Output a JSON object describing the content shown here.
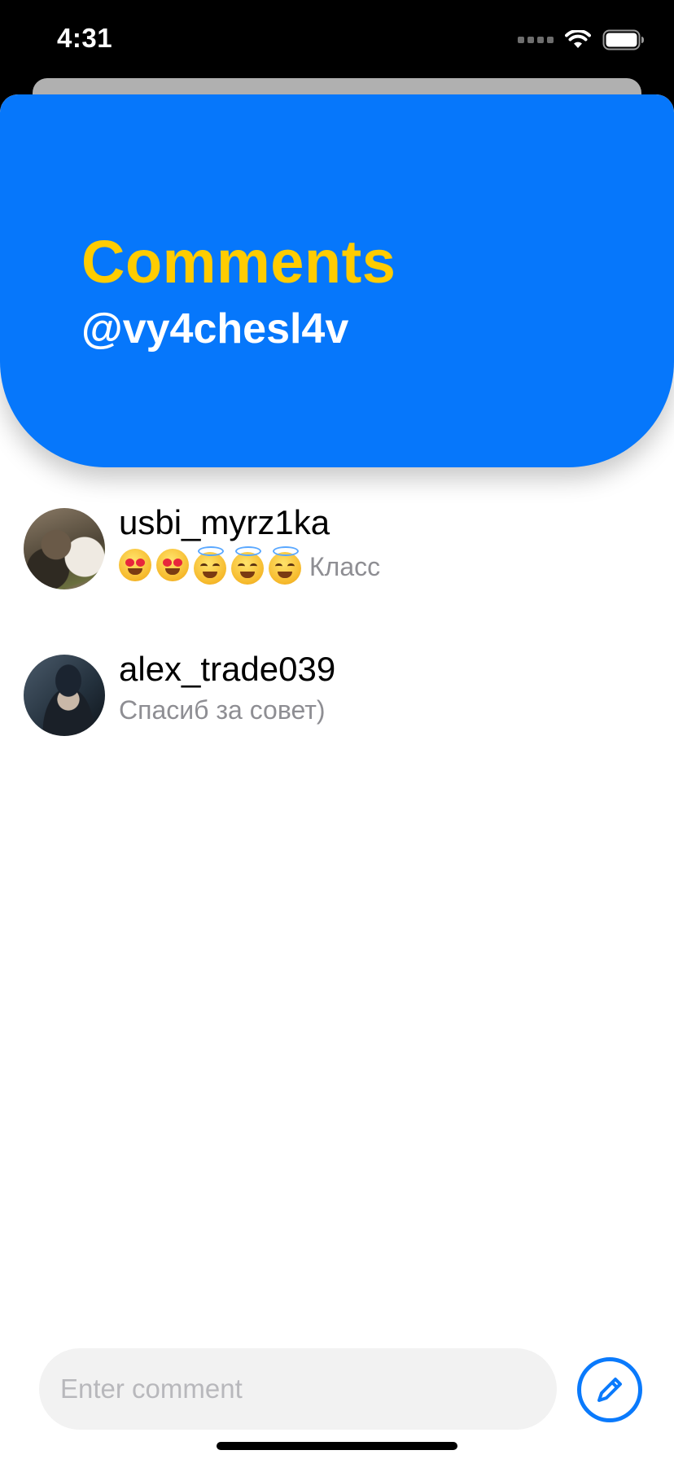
{
  "status_bar": {
    "time": "4:31",
    "icons": [
      "signal-icon",
      "wifi-icon",
      "battery-icon"
    ]
  },
  "header": {
    "title": "Comments",
    "subtitle": "@vy4chesl4v",
    "colors": {
      "background": "#0677fb",
      "title": "#ffcc00",
      "subtitle": "#ffffff"
    }
  },
  "comments": [
    {
      "author": "usbi_myrz1ka",
      "emojis": [
        "heart-eyes-emoji",
        "heart-eyes-emoji",
        "halo-emoji",
        "halo-emoji",
        "halo-emoji"
      ],
      "text": "Класс"
    },
    {
      "author": "alex_trade039",
      "emojis": [],
      "text": "Спасиб за совет)"
    }
  ],
  "composer": {
    "placeholder": "Enter comment",
    "value": "",
    "send_icon": "pencil-icon",
    "accent": "#0a7afc"
  }
}
